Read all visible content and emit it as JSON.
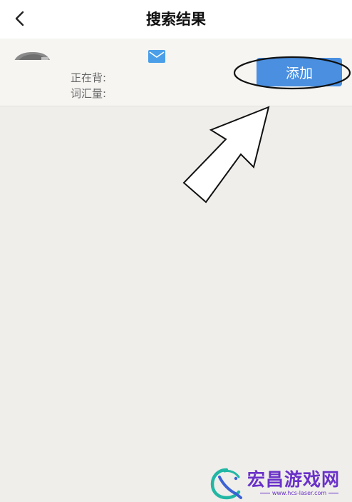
{
  "header": {
    "back_icon": "chevron-left-icon",
    "title": "搜索结果"
  },
  "result": {
    "avatar_icon": "avatar-image",
    "mail_icon": "mail-icon",
    "mail_color": "#4a9fe8",
    "learning_label": "正在背:",
    "vocab_label": "词汇量:",
    "add_label": "添加",
    "add_color": "#4a8fe0"
  },
  "watermark": {
    "name": "宏昌游戏网",
    "url": "www.hcs-laser.com",
    "color": "#6a31c8"
  }
}
